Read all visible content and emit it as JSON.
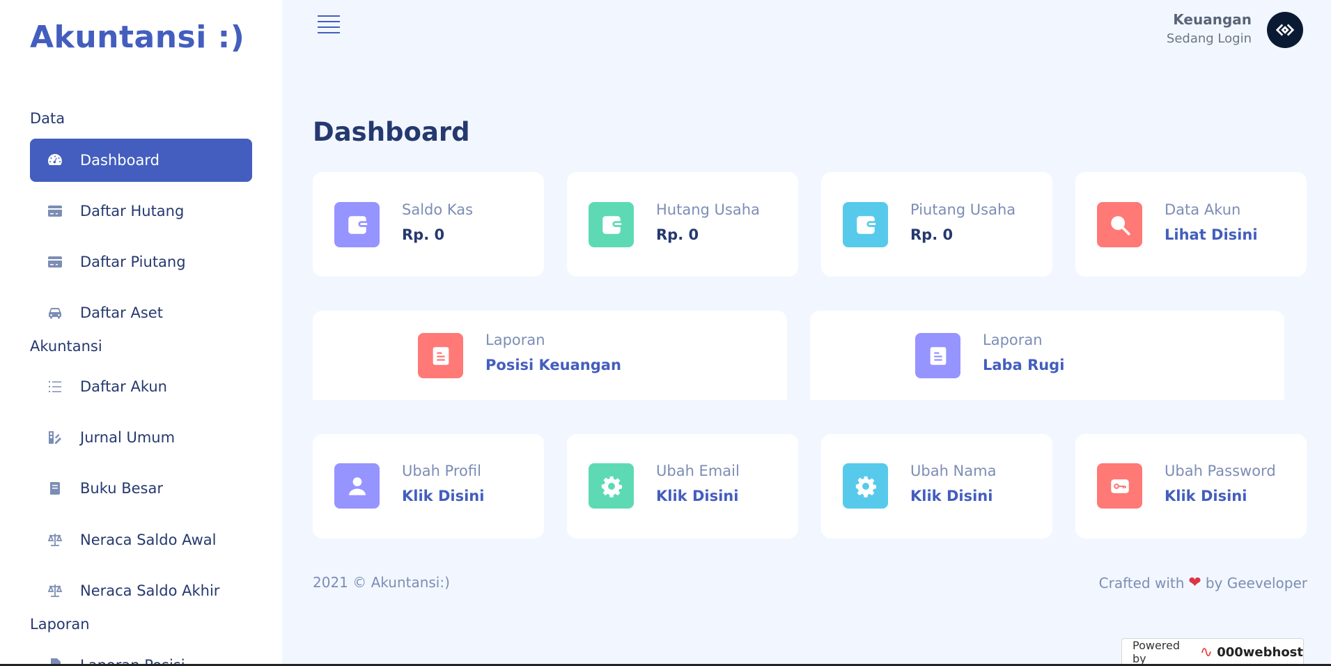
{
  "sidebar": {
    "brand": "Akuntansi :)",
    "sections": [
      {
        "title": "Data"
      },
      {
        "title": "Akuntansi"
      },
      {
        "title": "Laporan"
      }
    ],
    "items": [
      {
        "label": "Dashboard",
        "icon": "speedometer-icon",
        "active": true
      },
      {
        "label": "Daftar Hutang",
        "icon": "credit-card-icon"
      },
      {
        "label": "Daftar Piutang",
        "icon": "credit-card-icon"
      },
      {
        "label": "Daftar Aset",
        "icon": "car-icon"
      },
      {
        "label": "Daftar Akun",
        "icon": "list-icon"
      },
      {
        "label": "Jurnal Umum",
        "icon": "journal-icon"
      },
      {
        "label": "Buku Besar",
        "icon": "book-icon"
      },
      {
        "label": "Neraca Saldo Awal",
        "icon": "scale-icon"
      },
      {
        "label": "Neraca Saldo Akhir",
        "icon": "scale-icon"
      },
      {
        "label": "Laporan Posisi",
        "icon": "document-icon"
      }
    ]
  },
  "header": {
    "user_name": "Keuangan",
    "user_status": "Sedang Login"
  },
  "main": {
    "title": "Dashboard",
    "stats": [
      {
        "label": "Saldo Kas",
        "value": "Rp. 0",
        "icon": "wallet-icon",
        "color": "#9694ff"
      },
      {
        "label": "Hutang Usaha",
        "value": "Rp. 0",
        "icon": "wallet-icon",
        "color": "#5ddab4"
      },
      {
        "label": "Piutang Usaha",
        "value": "Rp. 0",
        "icon": "wallet-icon",
        "color": "#57caeb"
      },
      {
        "label": "Data Akun",
        "value": "Lihat Disini",
        "icon": "search-icon",
        "color": "#ff7976"
      }
    ],
    "reports": [
      {
        "label": "Laporan",
        "value": "Posisi Keuangan",
        "icon": "document-icon",
        "color": "#ff7976"
      },
      {
        "label": "Laporan",
        "value": "Laba Rugi",
        "icon": "document-icon",
        "color": "#9694ff"
      }
    ],
    "settings": [
      {
        "label": "Ubah Profil",
        "value": "Klik Disini",
        "icon": "person-icon",
        "color": "#9694ff"
      },
      {
        "label": "Ubah Email",
        "value": "Klik Disini",
        "icon": "gear-icon",
        "color": "#5ddab4"
      },
      {
        "label": "Ubah Nama",
        "value": "Klik Disini",
        "icon": "gear-icon",
        "color": "#57caeb"
      },
      {
        "label": "Ubah Password",
        "value": "Klik Disini",
        "icon": "key-icon",
        "color": "#ff7976"
      }
    ]
  },
  "footer": {
    "copyright": "2021 © Akuntansi:)",
    "crafted_prefix": "Crafted with",
    "crafted_suffix": "by Geeveloper"
  },
  "badge": {
    "powered_by": "Powered by",
    "brand": "000webhost"
  }
}
